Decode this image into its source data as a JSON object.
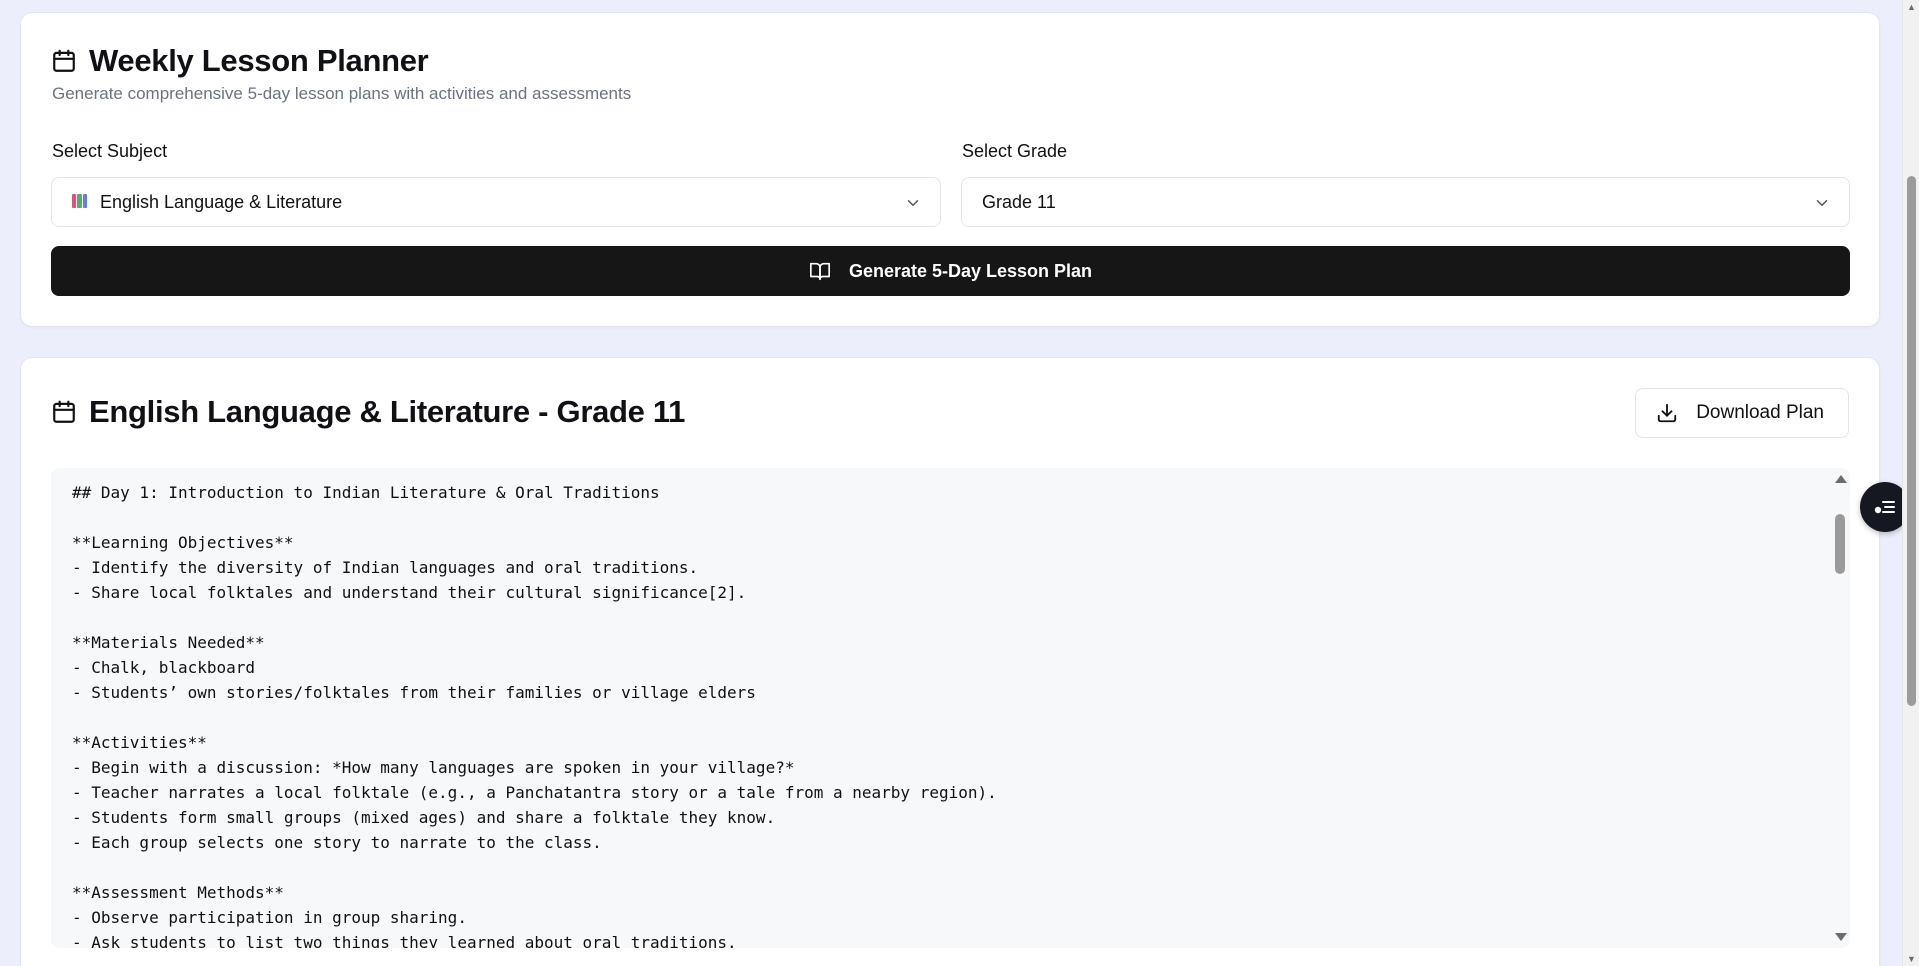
{
  "planner": {
    "title": "Weekly Lesson Planner",
    "subtitle": "Generate comprehensive 5-day lesson plans with activities and assessments",
    "subject_label": "Select Subject",
    "subject_value": "English Language & Literature",
    "grade_label": "Select Grade",
    "grade_value": "Grade 11",
    "generate_label": "Generate 5-Day Lesson Plan"
  },
  "result": {
    "title": "English Language & Literature - Grade 11",
    "download_label": "Download Plan",
    "plan_lines": [
      "## Day 1: Introduction to Indian Literature & Oral Traditions",
      "",
      "**Learning Objectives**",
      "- Identify the diversity of Indian languages and oral traditions.",
      "- Share local folktales and understand their cultural significance[2].",
      "",
      "**Materials Needed**",
      "- Chalk, blackboard",
      "- Students’ own stories/folktales from their families or village elders",
      "",
      "**Activities**",
      "- Begin with a discussion: *How many languages are spoken in your village?*",
      "- Teacher narrates a local folktale (e.g., a Panchatantra story or a tale from a nearby region).",
      "- Students form small groups (mixed ages) and share a folktale they know.",
      "- Each group selects one story to narrate to the class.",
      "",
      "**Assessment Methods**",
      "- Observe participation in group sharing.",
      "- Ask students to list two things they learned about oral traditions."
    ]
  },
  "icons": {
    "calendar": "calendar-icon",
    "book": "book-open-icon",
    "download": "download-icon",
    "chevron": "chevron-down-icon",
    "subject": "books-icon",
    "assistant": "assistant-icon"
  },
  "colors": {
    "background": "#eceefb",
    "primary_button": "#161616",
    "card": "#ffffff",
    "plan_bg": "#f7f8fa"
  }
}
